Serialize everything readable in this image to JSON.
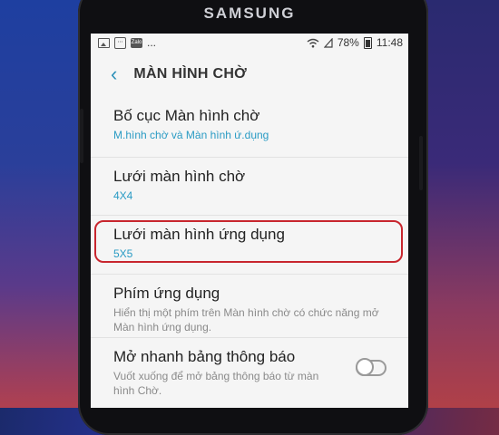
{
  "device": {
    "brand": "SAMSUNG"
  },
  "status_bar": {
    "zalo_label": "Zalo",
    "more": "...",
    "battery": "78%",
    "time": "11:48"
  },
  "header": {
    "title": "MÀN HÌNH CHỜ"
  },
  "settings": [
    {
      "title": "Bố cục Màn hình chờ",
      "value": "M.hình chờ và Màn hình ứ.dụng"
    },
    {
      "title": "Lưới màn hình chờ",
      "value": "4X4"
    },
    {
      "title": "Lưới màn hình ứng dụng",
      "value": "5X5",
      "highlighted": true
    },
    {
      "title": "Phím ứng dụng",
      "description": "Hiển thị một phím trên Màn hình chờ có chức năng mở Màn hình ứng dụng."
    },
    {
      "title": "Mở nhanh bảng thông báo",
      "description": "Vuốt xuống để mở bảng thông báo từ màn hình Chờ.",
      "toggle_on": false
    }
  ],
  "colors": {
    "accent": "#2a9bc4",
    "highlight": "#c8262e",
    "background": "#f5f5f5"
  }
}
